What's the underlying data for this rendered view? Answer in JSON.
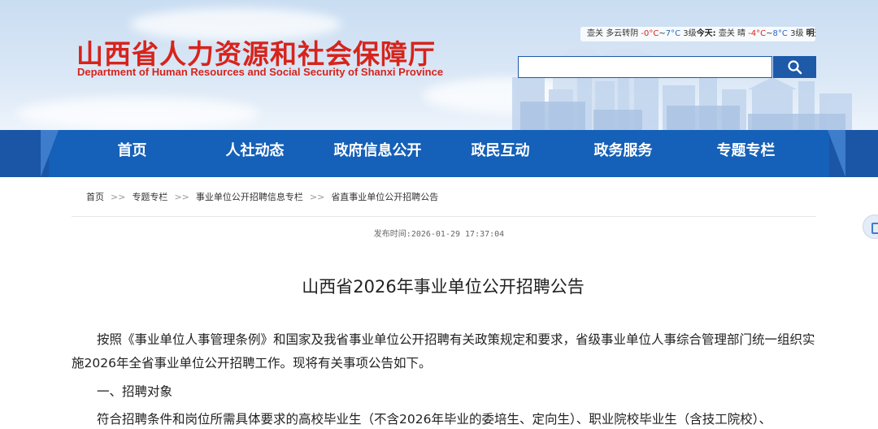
{
  "header": {
    "title_cn": "山西省人力资源和社会保障厅",
    "title_en": "Department of Human Resources and Social Security of Shanxi Province"
  },
  "weather": {
    "city1": "壶关",
    "cond1": "多云转阴",
    "low1": "-0°C",
    "sep1": "~",
    "high1": "7°C",
    "wind1": "3级",
    "today_label": "今天:",
    "city2": "壶关",
    "cond2": "晴",
    "low2": "-4°C",
    "sep2": "~",
    "high2": "8°C",
    "wind2": "3级",
    "tomorrow_label": "明天:"
  },
  "search": {
    "placeholder": "",
    "icon": "search-icon"
  },
  "nav": {
    "items": [
      "首页",
      "人社动态",
      "政府信息公开",
      "政民互动",
      "政务服务",
      "专题专栏"
    ]
  },
  "breadcrumb": {
    "items": [
      "首页",
      "专题专栏",
      "事业单位公开招聘信息专栏",
      "省直事业单位公开招聘公告"
    ],
    "separator": ">>"
  },
  "article": {
    "pub_label": "发布时间:",
    "pub_time": "2026-01-29 17:37:04",
    "title": "山西省2026年事业单位公开招聘公告",
    "para1": "　　按照《事业单位人事管理条例》和国家及我省事业单位公开招聘有关政策规定和要求，省级事业单位人事综合管理部门统一组织实施2026年全省事业单位公开招聘工作。现将有关事项公告如下。",
    "section1": "　　一、招聘对象",
    "para2": "　　符合招聘条件和岗位所需具体要求的高校毕业生（不含2026年毕业的委培生、定向生）、职业院校毕业生（含技工院校）、"
  },
  "colors": {
    "brand_red": "#d8231b",
    "nav_blue": "#1560b8"
  }
}
